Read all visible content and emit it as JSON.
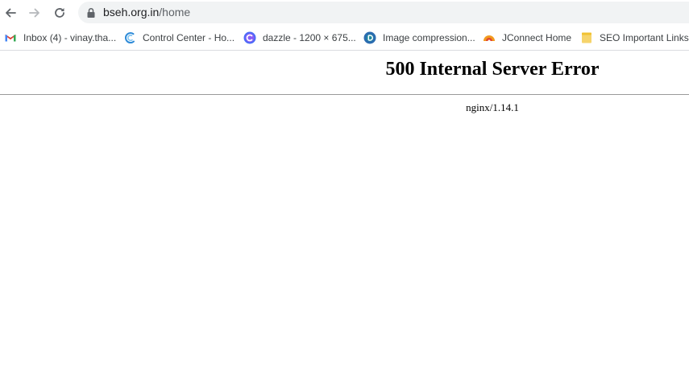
{
  "toolbar": {
    "url_host": "bseh.org.in",
    "url_path": "/home"
  },
  "bookmarks": [
    {
      "label": "Inbox (4) - vinay.tha...",
      "icon": "gmail-icon"
    },
    {
      "label": "Control Center - Ho...",
      "icon": "control-center-icon"
    },
    {
      "label": "dazzle - 1200 × 675...",
      "icon": "dazzle-icon"
    },
    {
      "label": "Image compression...",
      "icon": "image-compression-icon"
    },
    {
      "label": "JConnect Home",
      "icon": "jconnect-icon"
    },
    {
      "label": "SEO Important Links",
      "icon": "folder-icon"
    }
  ],
  "page": {
    "title": "500 Internal Server Error",
    "server": "nginx/1.14.1"
  },
  "colors": {
    "omnibox_bg": "#f1f3f4",
    "rule": "#9a9a9a",
    "gmail_red": "#ea4335"
  }
}
